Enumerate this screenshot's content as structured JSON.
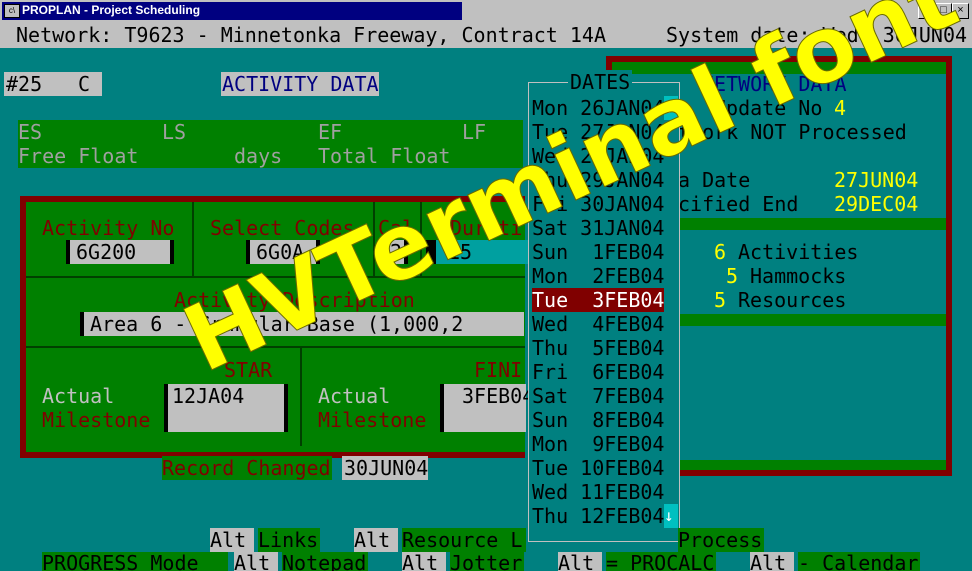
{
  "window": {
    "title": "PROPLAN - Project Scheduling",
    "icon": "terminal-app-icon",
    "minimize": "_",
    "maximize": "□",
    "close": "×"
  },
  "header": {
    "network": "Network: T9623 - Minnetonka Freeway, Contract 14A",
    "system_date": "System date: Wed, 30JUN04"
  },
  "activity": {
    "record_no": "#25",
    "code_letter": "C",
    "title": "ACTIVITY DATA",
    "es": "ES",
    "ls": "LS",
    "ef": "EF",
    "lf": "LF",
    "free_float": "Free Float",
    "days": "days",
    "total_float": "Total Float",
    "activity_no_label": "Activity No",
    "activity_no": "6G200",
    "select_codes_label": "Select Codes",
    "select_codes": "6G0A",
    "cal_label": "Cal",
    "cal": "2",
    "duration_label": "Durati",
    "duration": "15",
    "desc_label": "Activity Description",
    "description": "Area 6 - Granular Base (1,000,2",
    "start_label": "STAR",
    "actual_label": "Actual",
    "milestone_label": "Milestone",
    "start_value": "12JA04",
    "finish_label": "FINI",
    "actual2_label": "Actual",
    "milestone2_label": "Milestone",
    "finish_value": "3FEB04",
    "record_changed_label": "Record Changed",
    "record_changed": "30JUN04"
  },
  "network": {
    "title": "NETWORK DATA",
    "update_label": "Update No",
    "update_no": "4",
    "status": "twork NOT Processed",
    "date_label": "a Date",
    "date_value": "27JUN04",
    "end_label": "cified End",
    "end_value": "29DEC04",
    "activities_count": "6",
    "activities_label": "Activities",
    "hammocks_count": "5",
    "hammocks_label": "Hammocks",
    "resources_count": "5",
    "resources_label": "Resources"
  },
  "dates": {
    "title": "DATES",
    "up_arrow": "↑",
    "down_arrow": "↓",
    "items": [
      {
        "day": "Mon",
        "date": "26JAN04"
      },
      {
        "day": "Tue",
        "date": "27JAN04"
      },
      {
        "day": "Wed",
        "date": "28JAN04"
      },
      {
        "day": "Thu",
        "date": "29JAN04"
      },
      {
        "day": "Fri",
        "date": "30JAN04"
      },
      {
        "day": "Sat",
        "date": "31JAN04"
      },
      {
        "day": "Sun",
        "date": " 1FEB04"
      },
      {
        "day": "Mon",
        "date": " 2FEB04"
      },
      {
        "day": "Tue",
        "date": " 3FEB04"
      },
      {
        "day": "Wed",
        "date": " 4FEB04"
      },
      {
        "day": "Thu",
        "date": " 5FEB04"
      },
      {
        "day": "Fri",
        "date": " 6FEB04"
      },
      {
        "day": "Sat",
        "date": " 7FEB04"
      },
      {
        "day": "Sun",
        "date": " 8FEB04"
      },
      {
        "day": "Mon",
        "date": " 9FEB04"
      },
      {
        "day": "Tue",
        "date": "10FEB04"
      },
      {
        "day": "Wed",
        "date": "11FEB04"
      },
      {
        "day": "Thu",
        "date": "12FEB04"
      }
    ],
    "selected_index": 8
  },
  "footer": {
    "alt1": "Alt",
    "links": "Links",
    "alt2": "Alt",
    "resource": "Resource L",
    "process": "Process",
    "progress_mode": "PROGRESS Mode",
    "alt3": "Alt",
    "notepad": "Notepad",
    "alt4": "Alt",
    "jotter": "Jotter",
    "alt5": "Alt",
    "procalc": "= PROCALC",
    "alt6": "Alt",
    "calendar": "- Calendar"
  },
  "watermark": "HVTerminal font",
  "colors": {
    "background": "#008080",
    "panel_green": "#008000",
    "border_red": "#800000",
    "highlight_yellow": "#ffff00",
    "field_gray": "#c0c0c0",
    "selected_row": "#800000"
  }
}
